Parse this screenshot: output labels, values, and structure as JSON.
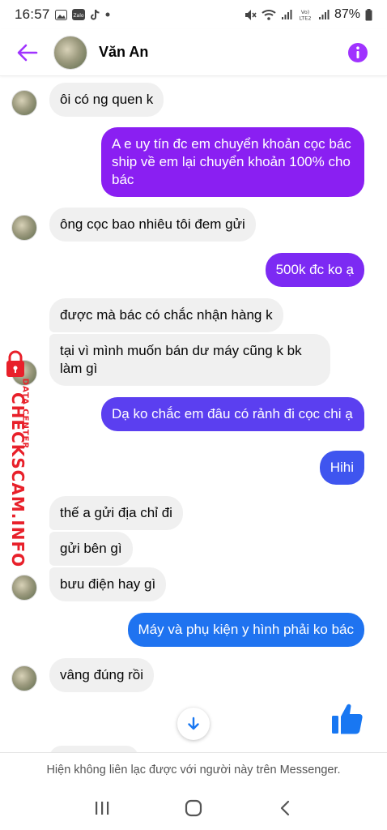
{
  "status_bar": {
    "time": "16:57",
    "left_icons": [
      "image-icon",
      "zalo-icon",
      "tiktok-icon",
      "dot-icon"
    ],
    "right_icons": [
      "mute-icon",
      "wifi-icon",
      "signal-icon",
      "volte-icon",
      "signal-icon"
    ],
    "volte_label": "Vo) LTE2",
    "battery": "87%"
  },
  "header": {
    "contact_name": "Văn An"
  },
  "messages": [
    {
      "side": "in",
      "text": "ôi có ng quen k"
    },
    {
      "side": "out",
      "text": "A e uy tín đc em chuyển khoản cọc bác ship về em lại chuyển khoản 100% cho bác"
    },
    {
      "side": "in",
      "text": "ông cọc bao nhiêu tôi đem gửi"
    },
    {
      "side": "out",
      "text": "500k đc ko ạ"
    },
    {
      "side": "in",
      "text": "được mà bác có chắc nhận hàng k"
    },
    {
      "side": "in",
      "text": "tại vì mình muốn bán dư máy cũng k bk làm gì"
    },
    {
      "side": "out",
      "text": "Dạ ko chắc em đâu có rảnh đi cọc chi ạ"
    },
    {
      "side": "out",
      "text": "Hihi"
    },
    {
      "side": "in",
      "text": "thế a gửi địa chỉ đi"
    },
    {
      "side": "in",
      "text": "gửi bên gì"
    },
    {
      "side": "in",
      "text": "bưu điện hay gì"
    },
    {
      "side": "out",
      "text": "Máy và phụ kiện y hình phải ko bác"
    },
    {
      "side": "in",
      "text": "vâng đúng rồi"
    }
  ],
  "notice": "Hiện không liên lạc được với người này trên Messenger.",
  "watermark": {
    "small": "DATA CENTER",
    "big": "CHECKSCAM.INFO"
  },
  "colors": {
    "accent": "#a033ff",
    "outgoing_top": "#8a1ff2",
    "outgoing_mid": "#5b3ff0",
    "outgoing_bottom": "#1f73f0",
    "incoming": "#f0f0f0",
    "like": "#1877f2",
    "watermark": "#e8202a"
  }
}
